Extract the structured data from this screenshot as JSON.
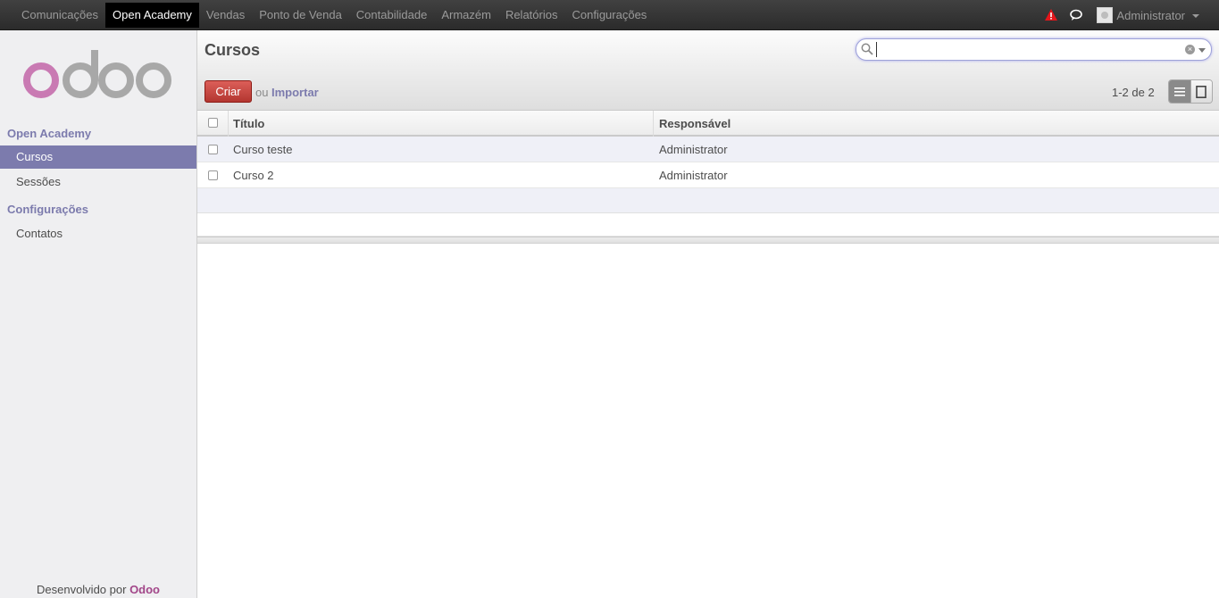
{
  "topbar": {
    "menu": [
      "Comunicações",
      "Open Academy",
      "Vendas",
      "Ponto de Venda",
      "Contabilidade",
      "Armazém",
      "Relatórios",
      "Configurações"
    ],
    "active_menu": "Open Academy",
    "user_name": "Administrator",
    "icons": [
      "warning-icon",
      "chat-icon",
      "avatar"
    ]
  },
  "sidebar": {
    "logo_text": "odoo",
    "sections": [
      {
        "title": "Open Academy",
        "items": [
          {
            "label": "Cursos",
            "active": true
          },
          {
            "label": "Sessões",
            "active": false
          }
        ]
      },
      {
        "title": "Configurações",
        "items": [
          {
            "label": "Contatos",
            "active": false
          }
        ]
      }
    ],
    "footer_prefix": "Desenvolvido por",
    "footer_brand": "Odoo"
  },
  "header": {
    "title": "Cursos",
    "search_value": "",
    "create_label": "Criar",
    "or_label": "ou",
    "import_label": "Importar",
    "pager": "1-2 de 2"
  },
  "table": {
    "columns": [
      "Título",
      "Responsável"
    ],
    "rows": [
      {
        "title": "Curso teste",
        "responsible": "Administrator"
      },
      {
        "title": "Curso 2",
        "responsible": "Administrator"
      }
    ]
  },
  "colors": {
    "accent": "#7c7bad",
    "brand": "#a24689",
    "create_button": "#c0392b"
  }
}
